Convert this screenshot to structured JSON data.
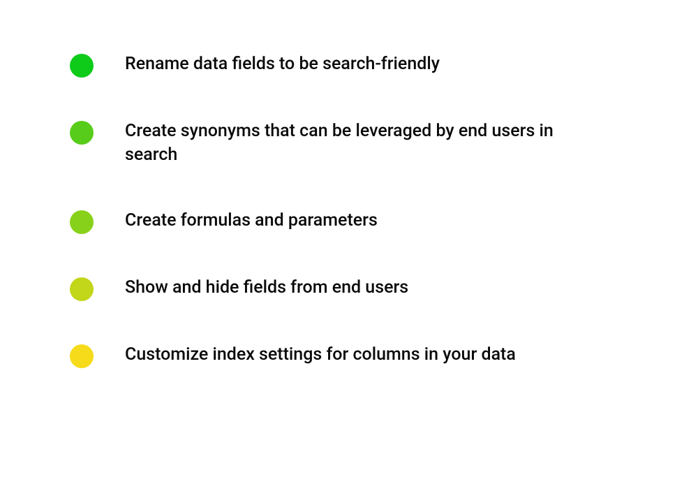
{
  "items": [
    {
      "text": "Rename data fields to be search-friendly",
      "color": "#0ecb1a"
    },
    {
      "text": "Create synonyms that can be leveraged by end users  in search",
      "color": "#58cc1a"
    },
    {
      "text": "Create formulas and parameters",
      "color": "#88d11a"
    },
    {
      "text": "Show and hide fields from end users",
      "color": "#c2d61a"
    },
    {
      "text": "Customize index settings for columns in your data",
      "color": "#f5db1a"
    }
  ]
}
